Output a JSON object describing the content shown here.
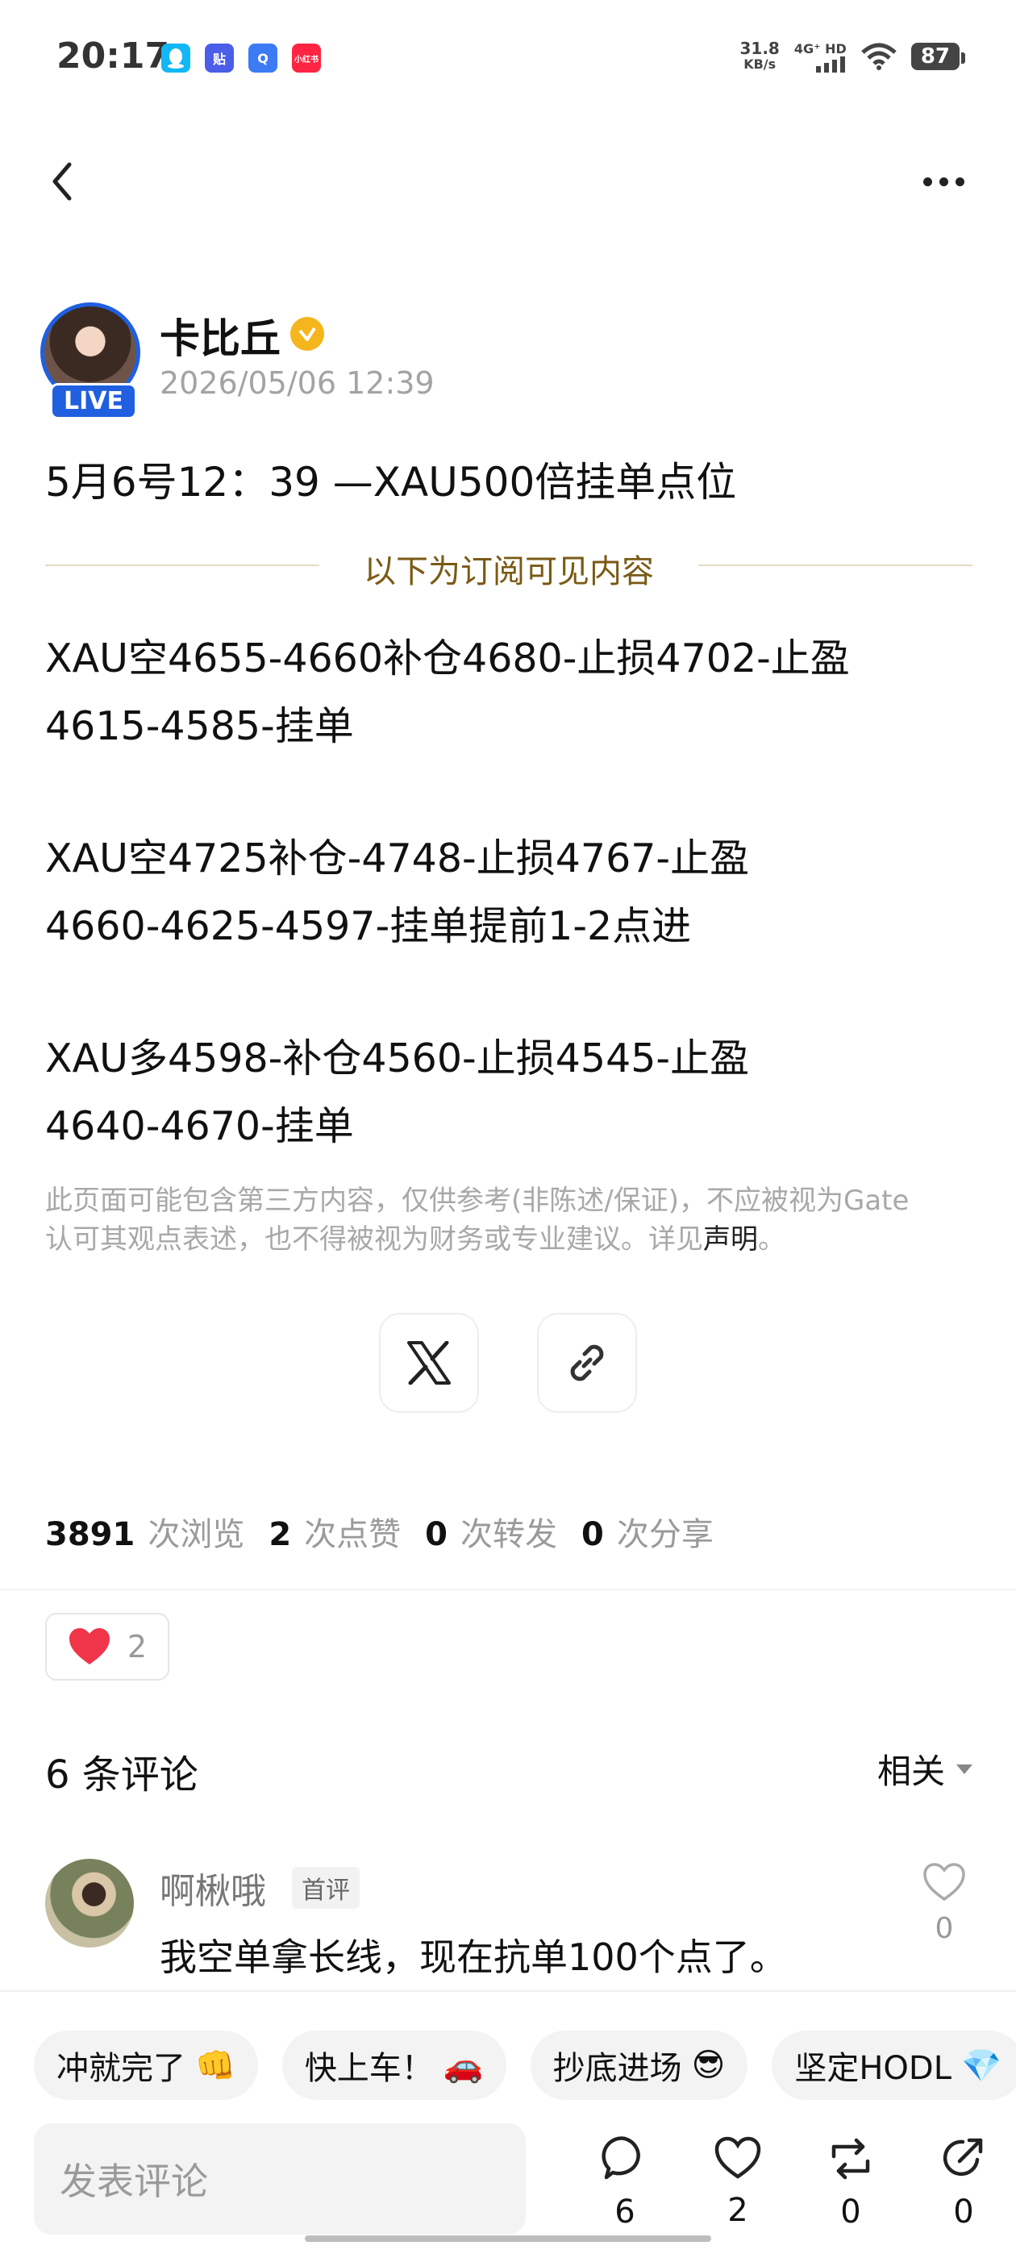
{
  "status_bar": {
    "time": "20:17",
    "app_icons": [
      {
        "icon": "qq-icon",
        "color": "#12b7f5",
        "label": ""
      },
      {
        "icon": "tieba-icon",
        "color": "#4a5ee8",
        "label": "贴"
      },
      {
        "icon": "browser-icon",
        "color": "#3d7bf5",
        "label": "Q"
      },
      {
        "icon": "xiaohongshu-icon",
        "color": "#ff2442",
        "label": "小红书"
      }
    ],
    "net_speed_value": "31.8",
    "net_speed_unit": "KB/s",
    "network": "4G⁺ HD",
    "battery": "87"
  },
  "nav": {
    "back_icon": "chevron-left-icon",
    "more_icon": "more-horizontal-icon"
  },
  "author": {
    "name": "卡比丘",
    "live_badge": "LIVE",
    "post_time": "2026/05/06 12:39",
    "verified_color": "#f5b51c"
  },
  "post": {
    "title": "5月6号12：39 —XAU500倍挂单点位",
    "subscriber_divider": "以下为订阅可见内容",
    "paragraphs": [
      [
        "XAU空4655-4660补仓4680-止损4702-止盈",
        "4615-4585-挂单"
      ],
      [
        "XAU空4725补仓-4748-止损4767-止盈",
        "4660-4625-4597-挂单提前1-2点进"
      ],
      [
        "XAU多4598-补仓4560-止损4545-止盈",
        "4640-4670-挂单"
      ]
    ],
    "disclaimer_line1": "此页面可能包含第三方内容，仅供参考(非陈述/保证)，不应被视为Gate",
    "disclaimer_line2": "认可其观点表述，也不得被视为财务或专业建议。详见",
    "disclaimer_link": "声明",
    "disclaimer_end": "。"
  },
  "share": {
    "x_icon": "x-logo-icon",
    "link_icon": "link-icon"
  },
  "stats": {
    "views": "3891",
    "views_label": "次浏览",
    "likes": "2",
    "likes_label": "次点赞",
    "reposts": "0",
    "reposts_label": "次转发",
    "shares": "0",
    "shares_label": "次分享"
  },
  "reactions": {
    "heart_count": "2"
  },
  "comments": {
    "header": "6 条评论",
    "sort_label": "相关",
    "items": [
      {
        "user": "啊楸哦",
        "badge": "首评",
        "text": "我空单拿长线，现在抗单100个点了。",
        "likes": "0"
      }
    ]
  },
  "quick_replies": [
    {
      "text": "冲就完了",
      "emoji": "👊"
    },
    {
      "text": "快上车！",
      "emoji": "🚗"
    },
    {
      "text": "抄底进场",
      "emoji": "😎"
    },
    {
      "text": "坚定HODL",
      "emoji": "💎"
    }
  ],
  "bottom_bar": {
    "input_placeholder": "发表评论",
    "comment_count": "6",
    "like_count": "2",
    "repost_count": "0",
    "share_count": "0"
  }
}
